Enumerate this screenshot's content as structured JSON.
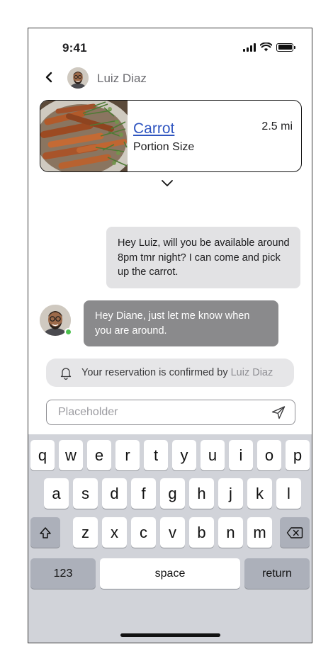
{
  "status_bar": {
    "time": "9:41"
  },
  "header": {
    "contact_name": "Luiz Diaz"
  },
  "listing": {
    "title": "Carrot",
    "subtitle": "Portion Size",
    "distance": "2.5 mi"
  },
  "messages": [
    {
      "direction": "outgoing",
      "text": "Hey Luiz, will you be available around 8pm tmr night? I can come and pick up the carrot."
    },
    {
      "direction": "incoming",
      "text": "Hey Diane, just let me know when you are around."
    }
  ],
  "notice": {
    "text": "Your reservation is confirmed by",
    "by": "Luiz Diaz"
  },
  "composer": {
    "placeholder": "Placeholder",
    "value": ""
  },
  "keyboard": {
    "row1": [
      "q",
      "w",
      "e",
      "r",
      "t",
      "y",
      "u",
      "i",
      "o",
      "p"
    ],
    "row2": [
      "a",
      "s",
      "d",
      "f",
      "g",
      "h",
      "j",
      "k",
      "l"
    ],
    "row3": [
      "z",
      "x",
      "c",
      "v",
      "b",
      "n",
      "m"
    ],
    "numbers_label": "123",
    "space_label": "space",
    "return_label": "return"
  },
  "colors": {
    "link": "#2f55c0",
    "outgoing_bubble": "#e2e2e4",
    "incoming_bubble": "#8a8a8c",
    "online": "#4cc04e",
    "keyboard_bg": "#d1d3d9"
  }
}
